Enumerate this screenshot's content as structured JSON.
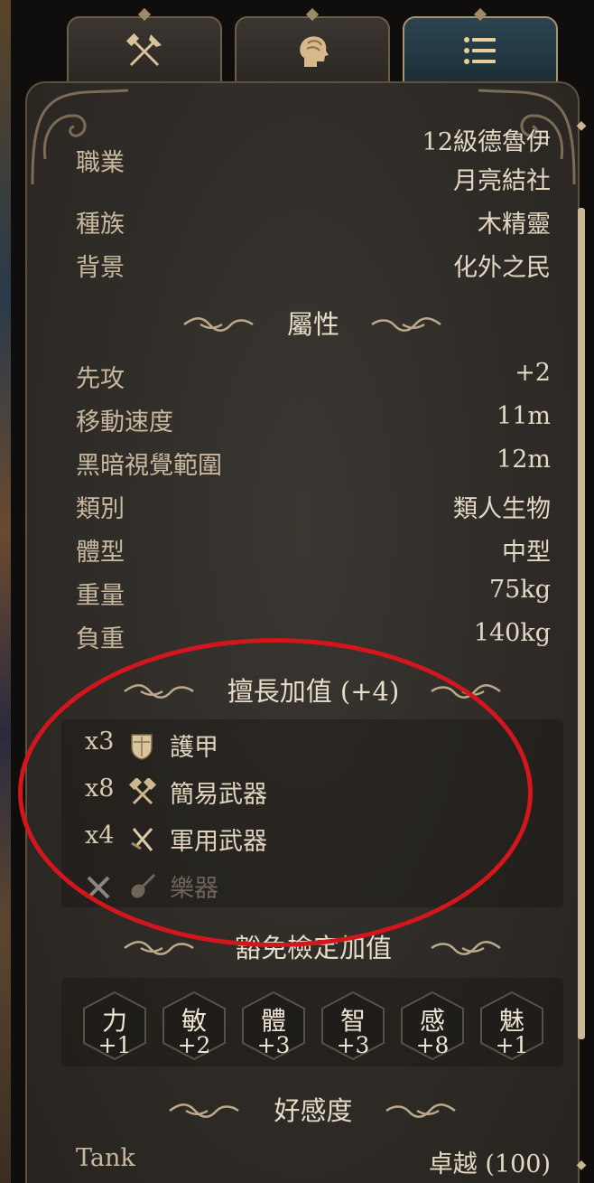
{
  "tabs": [
    {
      "icon": "axe-hammer-icon",
      "active": false
    },
    {
      "icon": "head-profile-icon",
      "active": false
    },
    {
      "icon": "list-icon",
      "active": true
    }
  ],
  "info": {
    "class_label": "職業",
    "class_line1": "12級德魯伊",
    "class_line2": "月亮結社",
    "race_label": "種族",
    "race_value": "木精靈",
    "background_label": "背景",
    "background_value": "化外之民"
  },
  "attributes": {
    "title": "屬性",
    "rows": [
      {
        "label": "先攻",
        "value": "+2"
      },
      {
        "label": "移動速度",
        "value": "11m"
      },
      {
        "label": "黑暗視覺範圍",
        "value": "12m"
      },
      {
        "label": "類別",
        "value": "類人生物"
      },
      {
        "label": "體型",
        "value": "中型"
      },
      {
        "label": "重量",
        "value": "75kg"
      },
      {
        "label": "負重",
        "value": "140kg"
      }
    ]
  },
  "proficiency": {
    "title": "擅長加值 (+4)",
    "items": [
      {
        "count": "x3",
        "icon": "armor-icon",
        "name": "護甲",
        "active": true
      },
      {
        "count": "x8",
        "icon": "crossed-hammers-icon",
        "name": "簡易武器",
        "active": true
      },
      {
        "count": "x4",
        "icon": "crossed-swords-icon",
        "name": "軍用武器",
        "active": true
      },
      {
        "count": "",
        "icon": "lute-icon",
        "name": "樂器",
        "active": false
      }
    ]
  },
  "saving_throws": {
    "title": "豁免檢定加值",
    "items": [
      {
        "ability": "力",
        "bonus": "+1"
      },
      {
        "ability": "敏",
        "bonus": "+2"
      },
      {
        "ability": "體",
        "bonus": "+3"
      },
      {
        "ability": "智",
        "bonus": "+3"
      },
      {
        "ability": "感",
        "bonus": "+8"
      },
      {
        "ability": "魅",
        "bonus": "+1"
      }
    ]
  },
  "approval": {
    "title": "好感度",
    "name": "Tank",
    "value": "卓越 (100)"
  },
  "colors": {
    "annotation_circle": "#d3161d",
    "panel_bg": "#2f2c28",
    "text_gold": "#e4d8c4"
  }
}
